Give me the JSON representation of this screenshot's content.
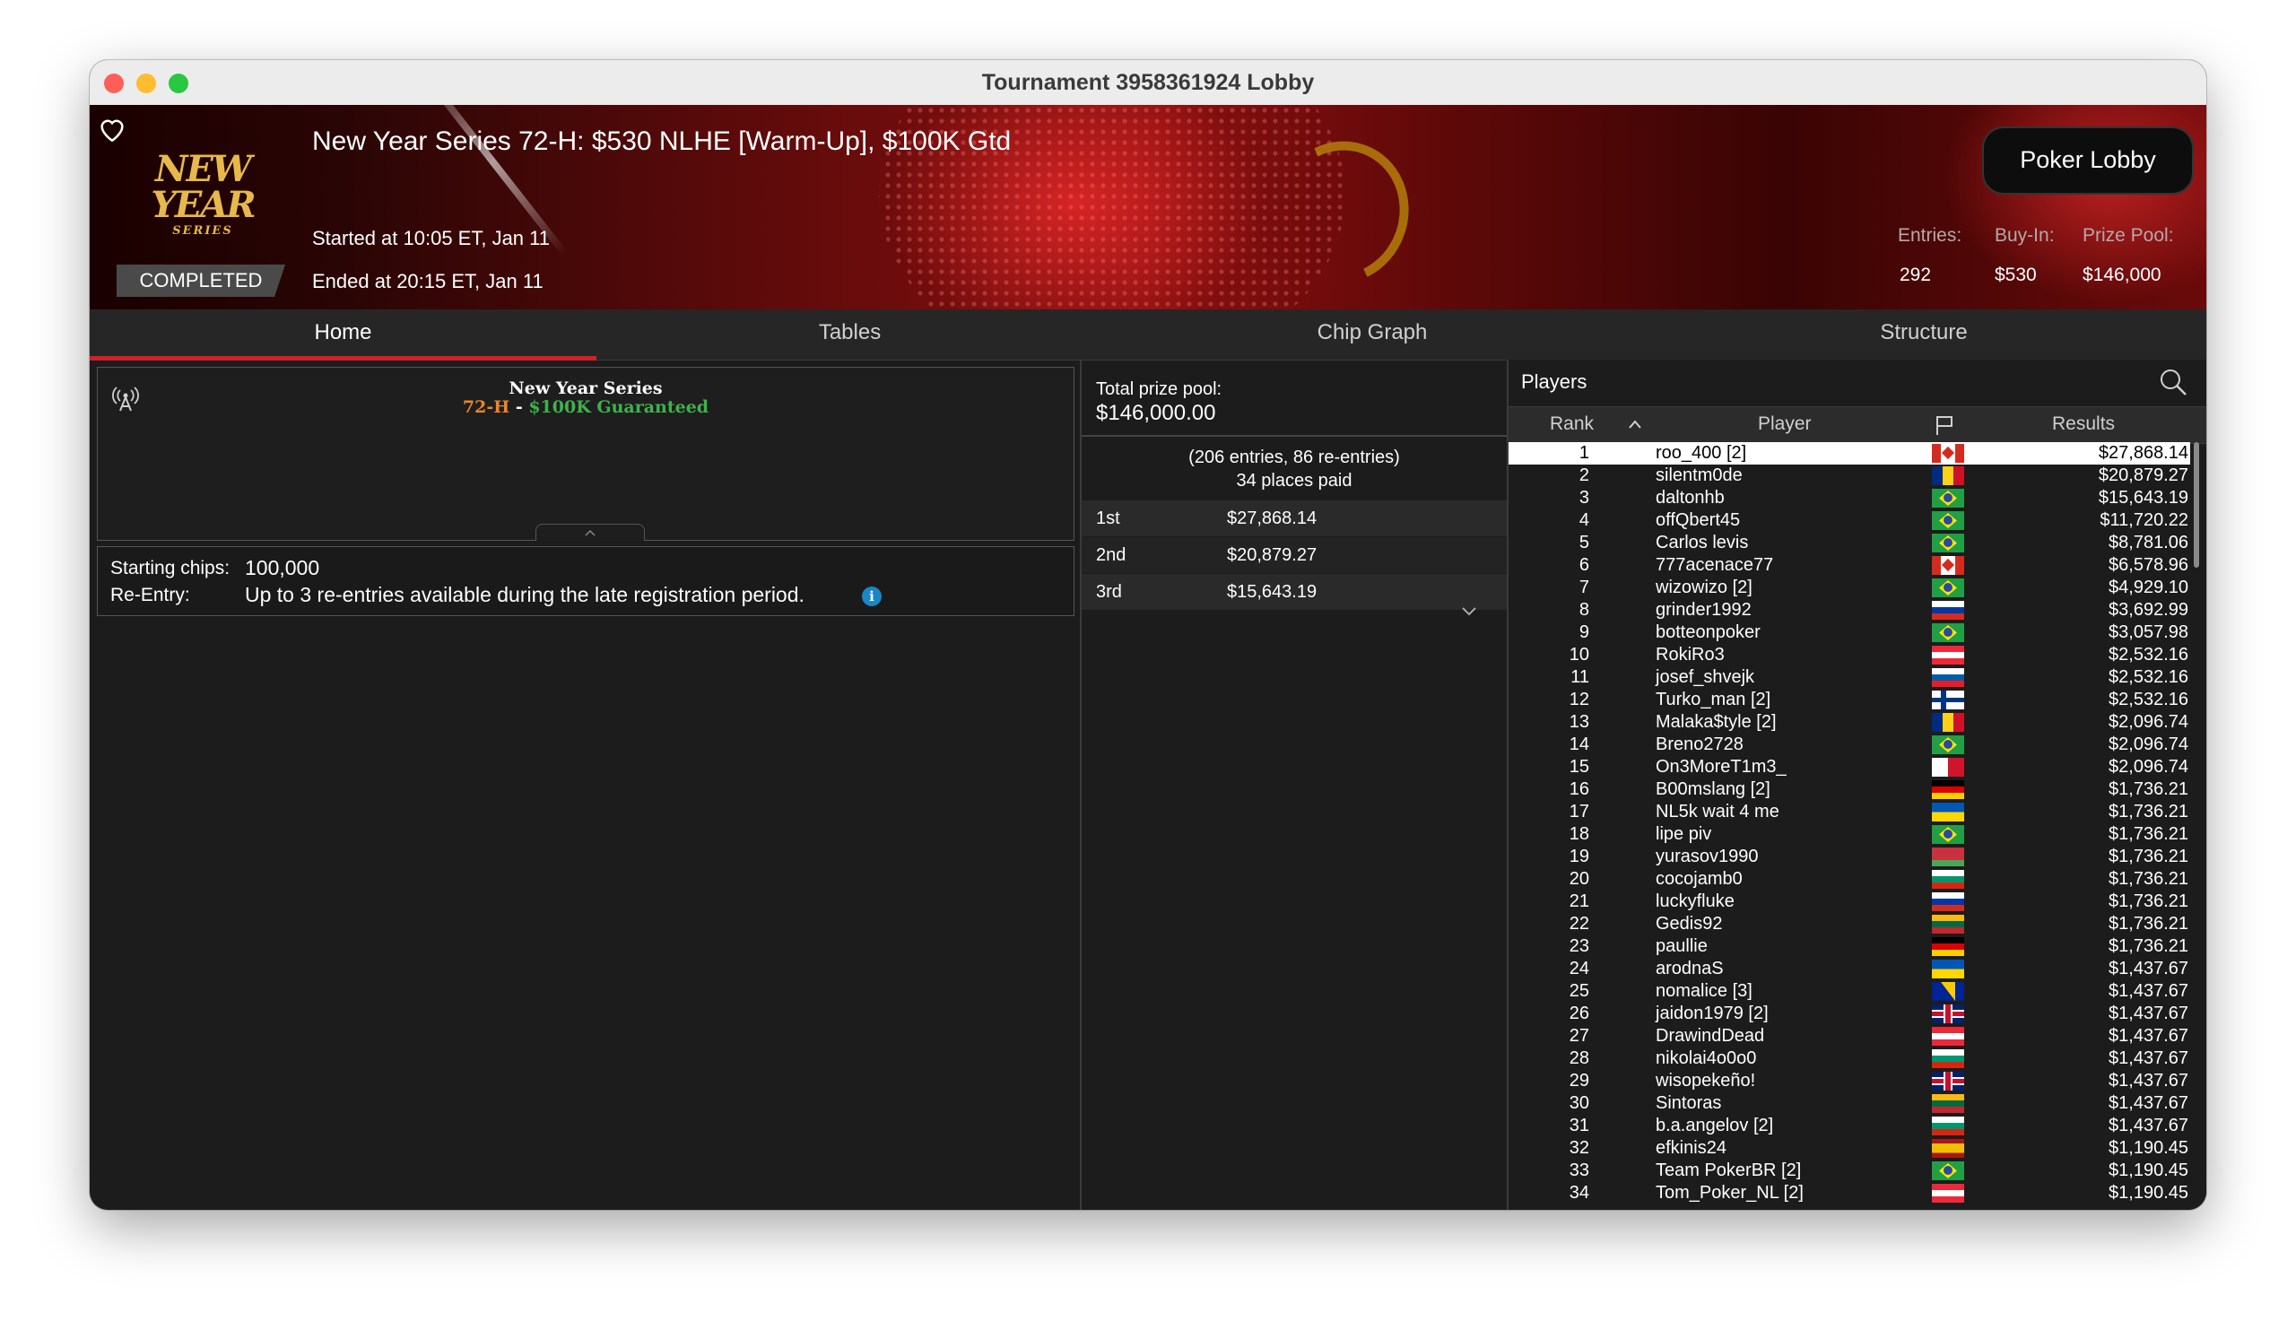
{
  "window": {
    "title": "Tournament 3958361924 Lobby"
  },
  "banner": {
    "logo": {
      "main": "NEW YEAR",
      "sub": "SERIES"
    },
    "tournament_name": "New Year Series 72-H: $530 NLHE [Warm-Up], $100K Gtd",
    "started": "Started at 10:05 ET, Jan 11",
    "ended": "Ended at 20:15 ET, Jan 11",
    "status": "COMPLETED",
    "lobby_button": "Poker Lobby",
    "stats": {
      "entries_label": "Entries:",
      "entries_value": "292",
      "buyin_label": "Buy-In:",
      "buyin_value": "$530",
      "prize_label": "Prize Pool:",
      "prize_value": "$146,000"
    }
  },
  "tabs": [
    "Home",
    "Tables",
    "Chip Graph",
    "Structure"
  ],
  "active_tab": "Home",
  "home": {
    "series_title": "New Year Series",
    "series_event": "72-H",
    "series_sep": " - ",
    "series_guarantee": "$100K Guaranteed",
    "starting_chips_label": "Starting chips:",
    "starting_chips_value": "100,000",
    "reentry_label": "Re-Entry:",
    "reentry_value": "Up to 3 re-entries available during the late registration period."
  },
  "prize": {
    "total_label": "Total prize pool:",
    "total_value": "$146,000.00",
    "entries_note": "(206 entries, 86 re-entries)",
    "places_paid": "34 places paid",
    "rows": [
      {
        "place": "1st",
        "amount": "$27,868.14"
      },
      {
        "place": "2nd",
        "amount": "$20,879.27"
      },
      {
        "place": "3rd",
        "amount": "$15,643.19"
      }
    ]
  },
  "players": {
    "title": "Players",
    "columns": {
      "rank": "Rank",
      "player": "Player",
      "results": "Results"
    },
    "selected_rank": 1,
    "rows": [
      {
        "rank": "1",
        "name": "roo_400 [2]",
        "flag": "ca",
        "result": "$27,868.14"
      },
      {
        "rank": "2",
        "name": "silentm0de",
        "flag": "ro",
        "result": "$20,879.27"
      },
      {
        "rank": "3",
        "name": "daltonhb",
        "flag": "br",
        "result": "$15,643.19"
      },
      {
        "rank": "4",
        "name": "offQbert45",
        "flag": "br",
        "result": "$11,720.22"
      },
      {
        "rank": "5",
        "name": "Carlos levis",
        "flag": "br",
        "result": "$8,781.06"
      },
      {
        "rank": "6",
        "name": "777acenace77",
        "flag": "ca",
        "result": "$6,578.96"
      },
      {
        "rank": "7",
        "name": "wizowizo [2]",
        "flag": "br",
        "result": "$4,929.10"
      },
      {
        "rank": "8",
        "name": "grinder1992",
        "flag": "ru",
        "result": "$3,692.99"
      },
      {
        "rank": "9",
        "name": "botteonpoker",
        "flag": "br",
        "result": "$3,057.98"
      },
      {
        "rank": "10",
        "name": "RokiRo3",
        "flag": "at",
        "result": "$2,532.16"
      },
      {
        "rank": "11",
        "name": "josef_shvejk",
        "flag": "si",
        "result": "$2,532.16"
      },
      {
        "rank": "12",
        "name": "Turko_man [2]",
        "flag": "fi",
        "result": "$2,532.16"
      },
      {
        "rank": "13",
        "name": "Malaka$tyle [2]",
        "flag": "ro",
        "result": "$2,096.74"
      },
      {
        "rank": "14",
        "name": "Breno2728",
        "flag": "br",
        "result": "$2,096.74"
      },
      {
        "rank": "15",
        "name": "On3MoreT1m3_",
        "flag": "mt",
        "result": "$2,096.74"
      },
      {
        "rank": "16",
        "name": "B00mslang [2]",
        "flag": "de",
        "result": "$1,736.21"
      },
      {
        "rank": "17",
        "name": "NL5k wait 4 me",
        "flag": "ua",
        "result": "$1,736.21"
      },
      {
        "rank": "18",
        "name": "lipe piv",
        "flag": "br",
        "result": "$1,736.21"
      },
      {
        "rank": "19",
        "name": "yurasov1990",
        "flag": "by",
        "result": "$1,736.21"
      },
      {
        "rank": "20",
        "name": "cocojamb0",
        "flag": "bg",
        "result": "$1,736.21"
      },
      {
        "rank": "21",
        "name": "luckyfluke",
        "flag": "ru",
        "result": "$1,736.21"
      },
      {
        "rank": "22",
        "name": "Gedis92",
        "flag": "lt",
        "result": "$1,736.21"
      },
      {
        "rank": "23",
        "name": "paullie",
        "flag": "de",
        "result": "$1,736.21"
      },
      {
        "rank": "24",
        "name": "arodnaS",
        "flag": "ua",
        "result": "$1,437.67"
      },
      {
        "rank": "25",
        "name": "nomalice [3]",
        "flag": "ba",
        "result": "$1,437.67"
      },
      {
        "rank": "26",
        "name": "jaidon1979 [2]",
        "flag": "gb",
        "result": "$1,437.67"
      },
      {
        "rank": "27",
        "name": "DrawindDead",
        "flag": "at",
        "result": "$1,437.67"
      },
      {
        "rank": "28",
        "name": "nikolai4o0o0",
        "flag": "bg",
        "result": "$1,437.67"
      },
      {
        "rank": "29",
        "name": "wisopekeño!",
        "flag": "gb",
        "result": "$1,437.67"
      },
      {
        "rank": "30",
        "name": "Sintoras",
        "flag": "lt",
        "result": "$1,437.67"
      },
      {
        "rank": "31",
        "name": "b.a.angelov [2]",
        "flag": "bg",
        "result": "$1,437.67"
      },
      {
        "rank": "32",
        "name": "efkinis24",
        "flag": "es",
        "result": "$1,190.45"
      },
      {
        "rank": "33",
        "name": "Team PokerBR [2]",
        "flag": "br",
        "result": "$1,190.45"
      },
      {
        "rank": "34",
        "name": "Tom_Poker_NL [2]",
        "flag": "at",
        "result": "$1,190.45"
      }
    ]
  },
  "colors": {
    "accent_red": "#d0202a",
    "series_orange": "#e8852a",
    "series_green": "#3cb34a",
    "info_blue": "#1a86c6"
  }
}
